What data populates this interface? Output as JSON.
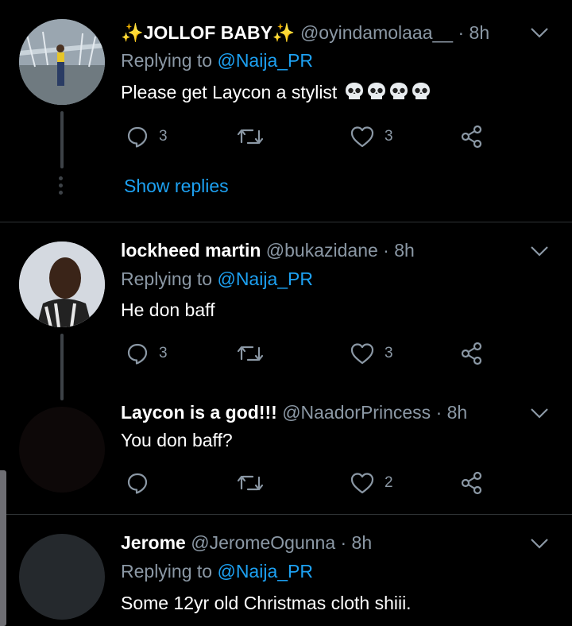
{
  "tweets": [
    {
      "name_prefix": "✨",
      "name": "JOLLOF BABY",
      "name_suffix": "✨",
      "handle": "@oyindamolaaa__",
      "time": "· 8h",
      "reply_prefix": "Replying to",
      "reply_to": "@Naija_PR",
      "text": "Please get Laycon a stylist",
      "emoji_count": 4,
      "emoji_name": "skull-emoji",
      "replies": "3",
      "retweets": "",
      "likes": "3",
      "show_replies": "Show replies"
    },
    {
      "name": "lockheed martin",
      "handle": "@bukazidane",
      "time": "· 8h",
      "reply_prefix": "Replying to",
      "reply_to": "@Naija_PR",
      "text": "He don baff",
      "replies": "3",
      "retweets": "",
      "likes": "3"
    },
    {
      "name": "Laycon is a god!!!",
      "handle": "@NaadorPrincess",
      "time": "· 8h",
      "text": "You don baff?",
      "replies": "",
      "retweets": "",
      "likes": "2"
    },
    {
      "name": "Jerome",
      "handle": "@JeromeOgunna",
      "time": "· 8h",
      "reply_prefix": "Replying to",
      "reply_to": "@Naija_PR",
      "text": "Some 12yr old Christmas cloth shiii."
    }
  ],
  "icons": [
    "reply-icon",
    "retweet-icon",
    "like-icon",
    "share-icon",
    "chevron-down-icon"
  ],
  "colors": {
    "background": "#000000",
    "secondary_text": "#8b98a5",
    "link": "#1da1f2",
    "separator": "#2f3336"
  }
}
